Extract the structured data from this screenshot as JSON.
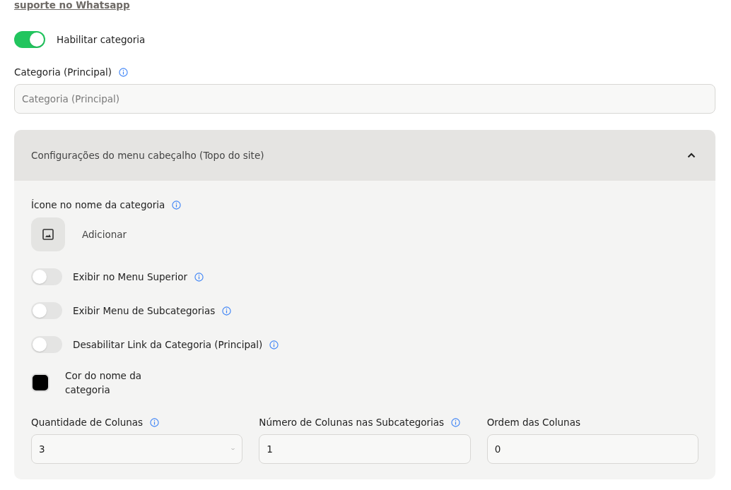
{
  "support_link": "suporte no Whatsapp",
  "enable_toggle": {
    "label": "Habilitar categoria",
    "on": true
  },
  "category_field": {
    "label": "Categoria (Principal)",
    "info": true,
    "placeholder": "Categoria (Principal)"
  },
  "panel": {
    "title": "Configurações do menu cabeçalho (Topo do site)",
    "expanded": true,
    "icon_field": {
      "label": "Ícone no nome da categoria",
      "info": true,
      "button": "Adicionar"
    },
    "toggles": [
      {
        "label": "Exibir no Menu Superior",
        "on": false,
        "info": true
      },
      {
        "label": "Exibir Menu de Subcategorias",
        "on": false,
        "info": true
      },
      {
        "label": "Desabilitar Link da Categoria (Principal)",
        "on": false,
        "info": true
      }
    ],
    "color_field": {
      "label": "Cor do nome da categoria",
      "color": "#000000"
    },
    "fields": [
      {
        "label": "Quantidade de Colunas",
        "info": true,
        "kind": "select",
        "value": "3"
      },
      {
        "label": "Número de Colunas nas Subcategorias",
        "info": true,
        "kind": "input",
        "value": "1"
      },
      {
        "label": "Ordem das Colunas",
        "info": false,
        "kind": "input",
        "value": "0"
      }
    ]
  }
}
